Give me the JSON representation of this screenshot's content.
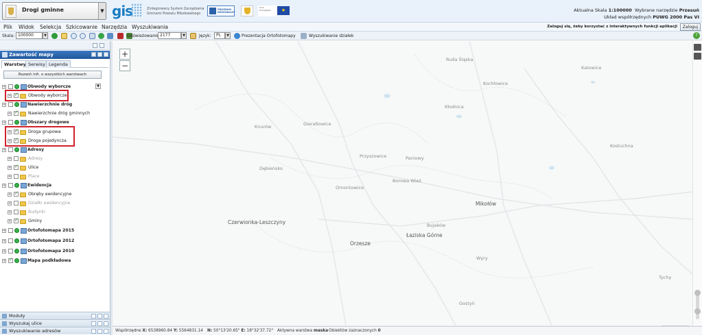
{
  "header": {
    "layer_select_label": "Drogi gminne",
    "gis_logo": "gis",
    "tagline_line1": "Zintegrowany System Zarządzania",
    "tagline_line2": "Gminami Powiatu Mikołowskiego",
    "logo_regional_text": "PROGRAM REGIONALNY",
    "logo_ue_text": "Unia Europejska",
    "scale_prefix": "Aktualna Skala",
    "scale_value": "1:100000",
    "tool_prefix": "Wybrane narzędzie",
    "tool_value": "Przesuń",
    "crs_prefix": "Układ współrzędnych",
    "crs_value": "PUWG 2000 Pas VI"
  },
  "menu": {
    "items": [
      "Plik",
      "Widok",
      "Selekcja",
      "Szkicowanie",
      "Narzędzia",
      "Wyszukiwania"
    ],
    "login_note": "Zaloguj się, żeby korzystać z interaktywnych funkcji aplikacji",
    "login_button": "Zaloguj"
  },
  "toolbar": {
    "scale_label": "Skala:",
    "scale_value": "100000",
    "refresh_label": "Odświeżowanie:",
    "refresh_value": "2177",
    "lang_label": "Język:",
    "lang_value": "PL",
    "ortho_label": "Prezentacja Ortofotomapy",
    "parcel_label": "Wyszukiwanie działek"
  },
  "panel": {
    "title": "Zawartość mapy",
    "tabs": [
      "Warstwy",
      "Serwisy",
      "Legenda"
    ],
    "expand_all": "Rozwiń infi. o wszystkich warstwach",
    "layers": [
      {
        "label": "Obwody wyborcze",
        "type": "group"
      },
      {
        "label": "Obwody wyborcze",
        "type": "layer"
      },
      {
        "label": "Nawierzchnie dróg",
        "type": "group"
      },
      {
        "label": "Nawierzchnie dróg gminnych",
        "type": "layer"
      },
      {
        "label": "Obszary drogowe",
        "type": "group"
      },
      {
        "label": "Droga grupowa",
        "type": "layer"
      },
      {
        "label": "Droga pojedyncza",
        "type": "layer"
      },
      {
        "label": "Adresy",
        "type": "group"
      },
      {
        "label": "Adresy",
        "type": "layer-dim"
      },
      {
        "label": "Ulice",
        "type": "layer"
      },
      {
        "label": "Place",
        "type": "layer-dim"
      },
      {
        "label": "Ewidencja",
        "type": "group"
      },
      {
        "label": "Obręby ewidencyjne",
        "type": "layer"
      },
      {
        "label": "Działki ewidencyjne",
        "type": "layer-dim"
      },
      {
        "label": "Budynki",
        "type": "layer-dim"
      },
      {
        "label": "Gminy",
        "type": "layer"
      },
      {
        "label": "Ortofotomapa 2015",
        "type": "group"
      },
      {
        "label": "Ortofotomapa 2012",
        "type": "group"
      },
      {
        "label": "Ortofotomapa 2010",
        "type": "group"
      },
      {
        "label": "Mapa podkładowa",
        "type": "group"
      }
    ],
    "footer": [
      "Moduły",
      "Wyszukaj ulice",
      "Wyszukiwanie adresów"
    ]
  },
  "map": {
    "zoom_in": "+",
    "zoom_out": "−",
    "places": [
      "Ruda Śląska",
      "Katowice",
      "Kochłowice",
      "Kłodnica",
      "Kostuchna",
      "Knurów",
      "Gierałtowice",
      "Przyszowice",
      "Paniowy",
      "Borowa Wieś",
      "Ornontowice",
      "Mikołów",
      "Bujaków",
      "Czerwionka-Leszczyny",
      "Łaziska Górne",
      "Orzesze",
      "Wyry",
      "Tychy",
      "Gostyń",
      "Dębieńsko"
    ]
  },
  "status": {
    "coords_prefix": "Współrzędne",
    "x_label": "X:",
    "x_value": "6538960.84",
    "y_label": "Y:",
    "y_value": "5564831.14",
    "n_label": "N:",
    "n_value": "50°13'20.65\"",
    "e_label": "E:",
    "e_value": "18°32'37.72\"",
    "active_layer_prefix": "Aktywna warstwa",
    "active_layer_value": "maska",
    "selected_prefix": "Obiektów zaznaczonych",
    "selected_value": "0"
  }
}
